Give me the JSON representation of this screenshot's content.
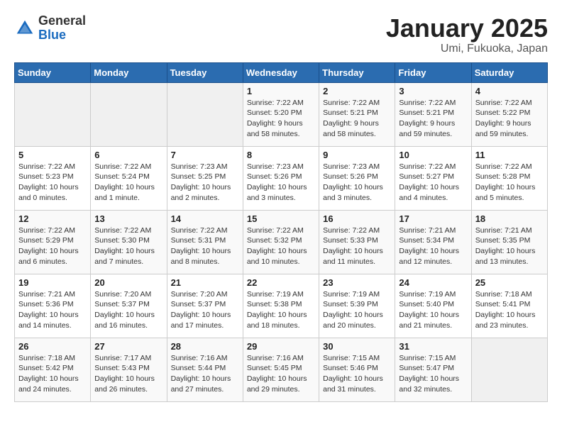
{
  "logo": {
    "general": "General",
    "blue": "Blue"
  },
  "title": "January 2025",
  "subtitle": "Umi, Fukuoka, Japan",
  "days_of_week": [
    "Sunday",
    "Monday",
    "Tuesday",
    "Wednesday",
    "Thursday",
    "Friday",
    "Saturday"
  ],
  "weeks": [
    [
      {
        "day": "",
        "info": ""
      },
      {
        "day": "",
        "info": ""
      },
      {
        "day": "",
        "info": ""
      },
      {
        "day": "1",
        "info": "Sunrise: 7:22 AM\nSunset: 5:20 PM\nDaylight: 9 hours\nand 58 minutes."
      },
      {
        "day": "2",
        "info": "Sunrise: 7:22 AM\nSunset: 5:21 PM\nDaylight: 9 hours\nand 58 minutes."
      },
      {
        "day": "3",
        "info": "Sunrise: 7:22 AM\nSunset: 5:21 PM\nDaylight: 9 hours\nand 59 minutes."
      },
      {
        "day": "4",
        "info": "Sunrise: 7:22 AM\nSunset: 5:22 PM\nDaylight: 9 hours\nand 59 minutes."
      }
    ],
    [
      {
        "day": "5",
        "info": "Sunrise: 7:22 AM\nSunset: 5:23 PM\nDaylight: 10 hours\nand 0 minutes."
      },
      {
        "day": "6",
        "info": "Sunrise: 7:22 AM\nSunset: 5:24 PM\nDaylight: 10 hours\nand 1 minute."
      },
      {
        "day": "7",
        "info": "Sunrise: 7:23 AM\nSunset: 5:25 PM\nDaylight: 10 hours\nand 2 minutes."
      },
      {
        "day": "8",
        "info": "Sunrise: 7:23 AM\nSunset: 5:26 PM\nDaylight: 10 hours\nand 3 minutes."
      },
      {
        "day": "9",
        "info": "Sunrise: 7:23 AM\nSunset: 5:26 PM\nDaylight: 10 hours\nand 3 minutes."
      },
      {
        "day": "10",
        "info": "Sunrise: 7:22 AM\nSunset: 5:27 PM\nDaylight: 10 hours\nand 4 minutes."
      },
      {
        "day": "11",
        "info": "Sunrise: 7:22 AM\nSunset: 5:28 PM\nDaylight: 10 hours\nand 5 minutes."
      }
    ],
    [
      {
        "day": "12",
        "info": "Sunrise: 7:22 AM\nSunset: 5:29 PM\nDaylight: 10 hours\nand 6 minutes."
      },
      {
        "day": "13",
        "info": "Sunrise: 7:22 AM\nSunset: 5:30 PM\nDaylight: 10 hours\nand 7 minutes."
      },
      {
        "day": "14",
        "info": "Sunrise: 7:22 AM\nSunset: 5:31 PM\nDaylight: 10 hours\nand 8 minutes."
      },
      {
        "day": "15",
        "info": "Sunrise: 7:22 AM\nSunset: 5:32 PM\nDaylight: 10 hours\nand 10 minutes."
      },
      {
        "day": "16",
        "info": "Sunrise: 7:22 AM\nSunset: 5:33 PM\nDaylight: 10 hours\nand 11 minutes."
      },
      {
        "day": "17",
        "info": "Sunrise: 7:21 AM\nSunset: 5:34 PM\nDaylight: 10 hours\nand 12 minutes."
      },
      {
        "day": "18",
        "info": "Sunrise: 7:21 AM\nSunset: 5:35 PM\nDaylight: 10 hours\nand 13 minutes."
      }
    ],
    [
      {
        "day": "19",
        "info": "Sunrise: 7:21 AM\nSunset: 5:36 PM\nDaylight: 10 hours\nand 14 minutes."
      },
      {
        "day": "20",
        "info": "Sunrise: 7:20 AM\nSunset: 5:37 PM\nDaylight: 10 hours\nand 16 minutes."
      },
      {
        "day": "21",
        "info": "Sunrise: 7:20 AM\nSunset: 5:37 PM\nDaylight: 10 hours\nand 17 minutes."
      },
      {
        "day": "22",
        "info": "Sunrise: 7:19 AM\nSunset: 5:38 PM\nDaylight: 10 hours\nand 18 minutes."
      },
      {
        "day": "23",
        "info": "Sunrise: 7:19 AM\nSunset: 5:39 PM\nDaylight: 10 hours\nand 20 minutes."
      },
      {
        "day": "24",
        "info": "Sunrise: 7:19 AM\nSunset: 5:40 PM\nDaylight: 10 hours\nand 21 minutes."
      },
      {
        "day": "25",
        "info": "Sunrise: 7:18 AM\nSunset: 5:41 PM\nDaylight: 10 hours\nand 23 minutes."
      }
    ],
    [
      {
        "day": "26",
        "info": "Sunrise: 7:18 AM\nSunset: 5:42 PM\nDaylight: 10 hours\nand 24 minutes."
      },
      {
        "day": "27",
        "info": "Sunrise: 7:17 AM\nSunset: 5:43 PM\nDaylight: 10 hours\nand 26 minutes."
      },
      {
        "day": "28",
        "info": "Sunrise: 7:16 AM\nSunset: 5:44 PM\nDaylight: 10 hours\nand 27 minutes."
      },
      {
        "day": "29",
        "info": "Sunrise: 7:16 AM\nSunset: 5:45 PM\nDaylight: 10 hours\nand 29 minutes."
      },
      {
        "day": "30",
        "info": "Sunrise: 7:15 AM\nSunset: 5:46 PM\nDaylight: 10 hours\nand 31 minutes."
      },
      {
        "day": "31",
        "info": "Sunrise: 7:15 AM\nSunset: 5:47 PM\nDaylight: 10 hours\nand 32 minutes."
      },
      {
        "day": "",
        "info": ""
      }
    ]
  ]
}
